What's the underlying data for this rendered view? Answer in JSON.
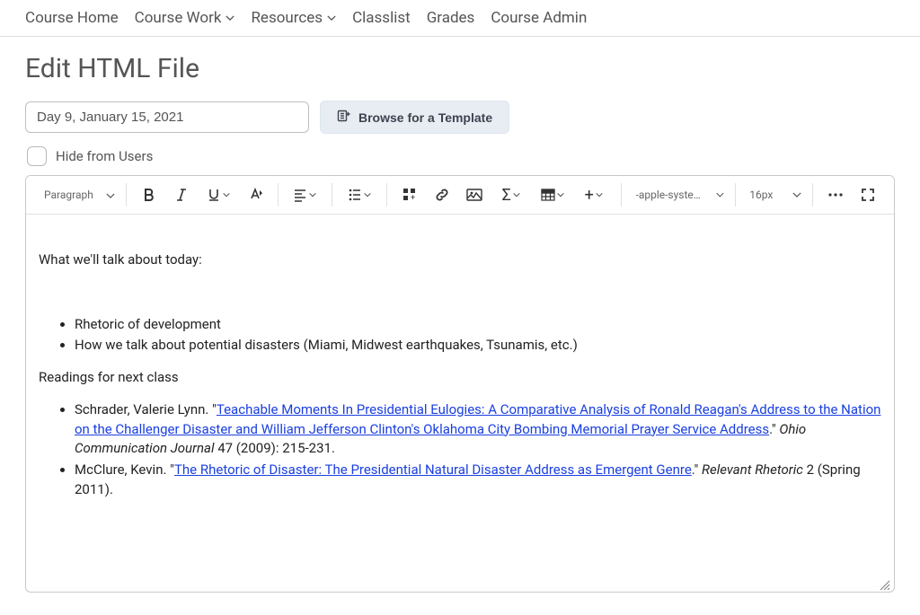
{
  "nav": {
    "items": [
      {
        "label": "Course Home",
        "dropdown": false
      },
      {
        "label": "Course Work",
        "dropdown": true
      },
      {
        "label": "Resources",
        "dropdown": true
      },
      {
        "label": "Classlist",
        "dropdown": false
      },
      {
        "label": "Grades",
        "dropdown": false
      },
      {
        "label": "Course Admin",
        "dropdown": false
      }
    ]
  },
  "page": {
    "title": "Edit HTML File",
    "file_title_value": "Day 9, January 15, 2021",
    "browse_template_label": "Browse for a Template",
    "hide_label": "Hide from Users"
  },
  "toolbar": {
    "block_format": "Paragraph",
    "font_name": "-apple-system,…",
    "font_size": "16px"
  },
  "editor_content": {
    "intro": "What we'll talk about today:",
    "bullets": [
      "Rhetoric of development",
      "How we talk about potential disasters (Miami, Midwest earthquakes, Tsunamis, etc.)"
    ],
    "readings_header": "Readings for next class",
    "readings": [
      {
        "author_prefix": "Schrader, Valerie Lynn. \"",
        "link_text": "Teachable Moments In Presidential Eulogies: A Comparative Analysis of Ronald Reagan's Address to the Nation on the Challenger Disaster and William Jefferson Clinton's Oklahoma City Bombing Memorial Prayer Service Address",
        "after_link": ".\" ",
        "italic_source": "Ohio Communication Journal",
        "tail": " 47 (2009): 215-231."
      },
      {
        "author_prefix": "McClure, Kevin. \"",
        "link_text": "The Rhetoric of Disaster: The Presidential Natural Disaster Address as Emergent Genre",
        "after_link": ".\" ",
        "italic_source": "Relevant Rhetoric",
        "tail": " 2 (Spring 2011)."
      }
    ]
  }
}
